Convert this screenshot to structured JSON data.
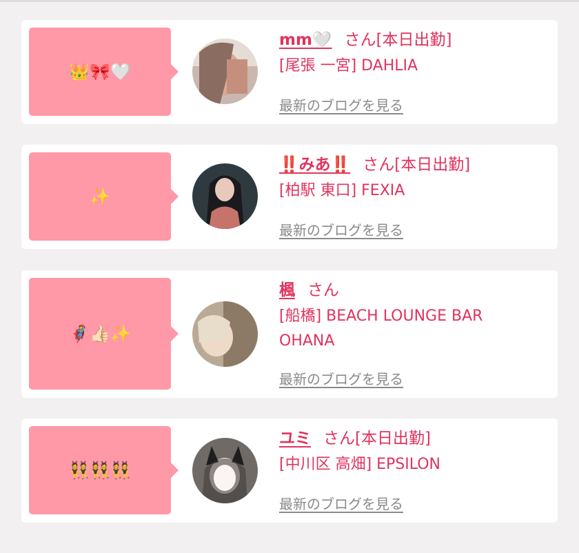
{
  "cards": [
    {
      "emoji": "👑🎀🤍",
      "name": "mm🤍",
      "suffix": "さん[本日出勤]",
      "shop": "[尾張 一宮] DAHLIA",
      "blog_link": "最新のブログを見る"
    },
    {
      "emoji": "✨",
      "name": "‼️みあ‼️",
      "suffix": "さん[本日出勤]",
      "shop": "[柏駅 東口] FEXIA",
      "blog_link": "最新のブログを見る"
    },
    {
      "emoji": "🦸👍🏻✨",
      "name": "楓",
      "suffix": "さん",
      "shop": "[船橋] BEACH LOUNGE BAR OHANA",
      "blog_link": "最新のブログを見る"
    },
    {
      "emoji": "👯👯👯",
      "name": "ユミ",
      "suffix": "さん[本日出勤]",
      "shop": "[中川区 高畑] EPSILON",
      "blog_link": "最新のブログを見る"
    }
  ],
  "colors": {
    "accent": "#e0335d",
    "bubble": "#ff98a7",
    "link_gray": "#8a8a8a",
    "background": "#f2f0f1"
  }
}
